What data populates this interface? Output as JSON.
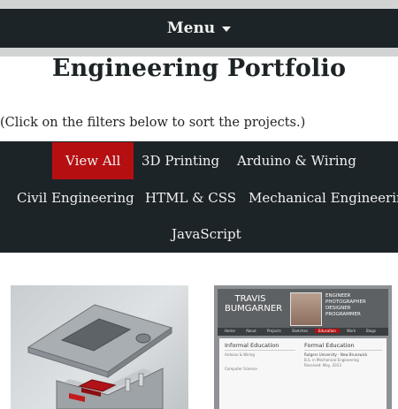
{
  "menu": {
    "label": "Menu",
    "caret_icon": "chevron-down-icon"
  },
  "page": {
    "title": "Engineering Portfolio",
    "instruction": "(Click on the filters below to sort the projects.)"
  },
  "colors": {
    "dark": "#1d2427",
    "active_filter": "#b50f12",
    "light_strip": "#d2d4d4"
  },
  "filters": [
    {
      "label": "View All",
      "active": true
    },
    {
      "label": "3D Printing",
      "active": false
    },
    {
      "label": "Arduino & Wiring",
      "active": false
    },
    {
      "label": "Civil Engineering",
      "active": false
    },
    {
      "label": "HTML & CSS",
      "active": false
    },
    {
      "label": "Mechanical Engineering",
      "active": false
    },
    {
      "label": "JavaScript",
      "active": false
    }
  ],
  "projects": {
    "resume_site": {
      "name_line1": "TRAVIS",
      "name_line2": "BUMGARNER",
      "tags": [
        "ENGINEER",
        "PHOTOGRAPHER",
        "DESIGNER",
        "PROGRAMMER"
      ],
      "nav": [
        "Home",
        "About",
        "Projects",
        "Sketches",
        "Education",
        "Work",
        "Blogs"
      ],
      "col1_heading": "Informal Education",
      "col1_sub1": "Arduino & Wiring",
      "col1_sub2": "Computer Science",
      "col2_heading": "Formal Education",
      "col2_school": "Rutgers University - New Brunswick",
      "col2_degree": "B.S. in Mechanical Engineering",
      "col2_date": "Received: May, 2013"
    }
  }
}
